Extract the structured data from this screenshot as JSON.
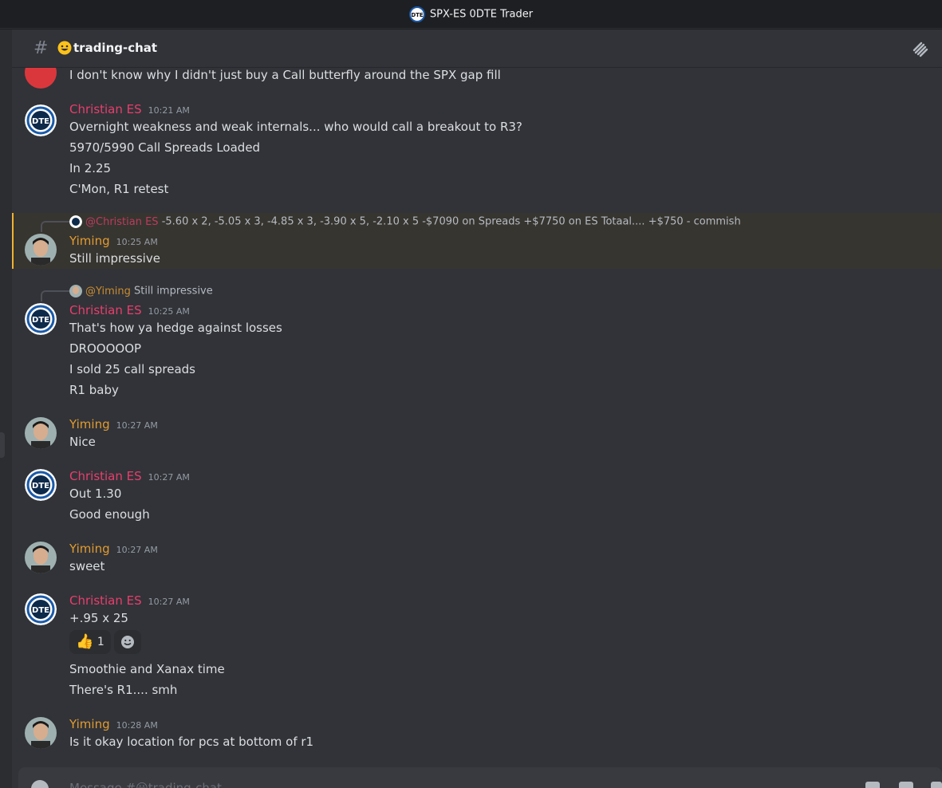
{
  "window": {
    "title": "SPX-ES 0DTE Trader"
  },
  "channel": {
    "name": "trading-chat",
    "emoji_icon": "grinning-face-icon"
  },
  "messages": {
    "top_partial": {
      "text": "I don't know why I didn't just buy a Call butterfly around the SPX gap fill"
    },
    "m1": {
      "author": "Christian ES",
      "time": "10:21 AM",
      "lines": [
        "Overnight weakness and weak internals... who would call a breakout to R3?",
        "5970/5990 Call Spreads Loaded",
        "In 2.25",
        "C'Mon, R1 retest"
      ]
    },
    "m2": {
      "reply_mention": "@Christian ES",
      "reply_text": "-5.60 x 2,  -5.05 x 3,  -4.85 x 3,  -3.90 x 5,  -2.10 x 5    -$7090 on Spreads    +$7750 on ES     Totaal....  +$750 - commish",
      "author": "Yiming",
      "time": "10:25 AM",
      "lines": [
        "Still impressive"
      ]
    },
    "m3": {
      "reply_mention": "@Yiming",
      "reply_text": "Still impressive",
      "author": "Christian ES",
      "time": "10:25 AM",
      "lines": [
        "That's how ya hedge against losses",
        "DROOOOOP",
        "I sold 25 call spreads",
        "R1 baby"
      ]
    },
    "m4": {
      "author": "Yiming",
      "time": "10:27 AM",
      "lines": [
        "Nice"
      ]
    },
    "m5": {
      "author": "Christian ES",
      "time": "10:27 AM",
      "lines": [
        "Out 1.30",
        "Good enough"
      ]
    },
    "m6": {
      "author": "Yiming",
      "time": "10:27 AM",
      "lines": [
        "sweet"
      ]
    },
    "m7": {
      "author": "Christian ES",
      "time": "10:27 AM",
      "lines": [
        "+.95 x 25",
        "Smoothie and Xanax time",
        "There's R1....  smh"
      ],
      "reactions": [
        {
          "emoji": "👍",
          "count": "1"
        }
      ]
    },
    "m8": {
      "author": "Yiming",
      "time": "10:28 AM",
      "lines": [
        "Is it okay location for pcs at bottom of r1"
      ]
    }
  },
  "composer": {
    "placeholder": "Message #😃trading-chat"
  },
  "colors": {
    "christian": "#e83e6c",
    "yiming": "#e39b2f",
    "background": "#313338",
    "highlight": "#f0b232"
  }
}
